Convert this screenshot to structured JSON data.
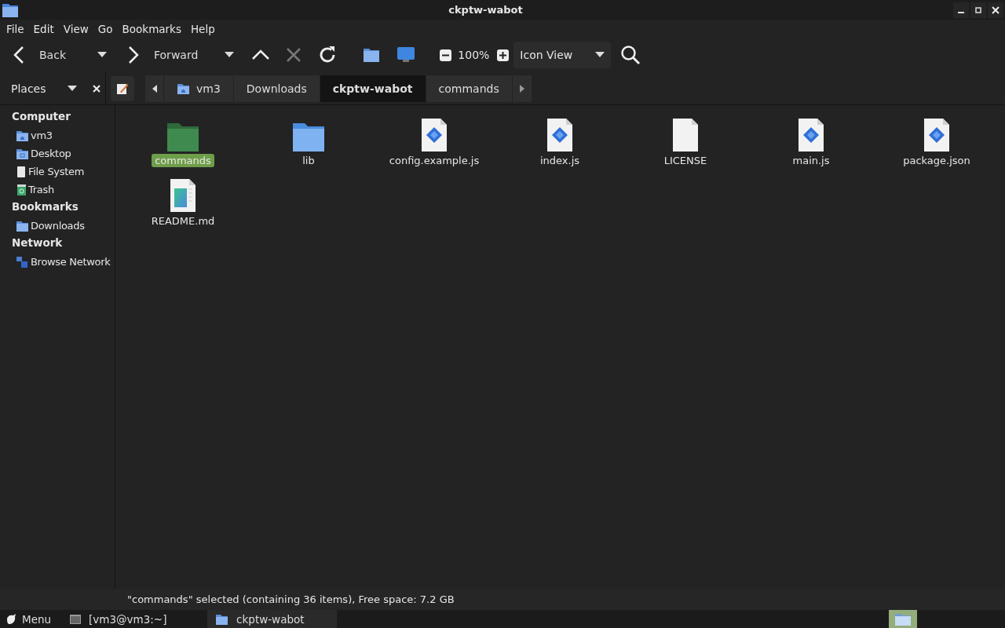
{
  "window": {
    "title": "ckptw-wabot"
  },
  "menu": [
    "File",
    "Edit",
    "View",
    "Go",
    "Bookmarks",
    "Help"
  ],
  "toolbar": {
    "back": "Back",
    "forward": "Forward",
    "stop_disabled": true,
    "zoom": "100%",
    "view": "Icon View"
  },
  "sidebar": {
    "label": "Places",
    "sections": [
      {
        "title": "Computer",
        "items": [
          {
            "label": "vm3",
            "kind": "home"
          },
          {
            "label": "Desktop",
            "kind": "desktop"
          },
          {
            "label": "File System",
            "kind": "drive"
          },
          {
            "label": "Trash",
            "kind": "trash"
          }
        ]
      },
      {
        "title": "Bookmarks",
        "items": [
          {
            "label": "Downloads",
            "kind": "folder"
          }
        ]
      },
      {
        "title": "Network",
        "items": [
          {
            "label": "Browse Network",
            "kind": "network"
          }
        ]
      }
    ]
  },
  "breadcrumb": [
    {
      "label": "vm3",
      "kind": "home",
      "selected": false
    },
    {
      "label": "Downloads",
      "kind": "plain",
      "selected": false
    },
    {
      "label": "ckptw-wabot",
      "kind": "plain",
      "selected": true
    },
    {
      "label": "commands",
      "kind": "plain",
      "selected": false
    }
  ],
  "files": [
    {
      "name": "commands",
      "kind": "folder",
      "selected": true
    },
    {
      "name": "lib",
      "kind": "folder",
      "selected": false
    },
    {
      "name": "config.example.js",
      "kind": "script",
      "selected": false
    },
    {
      "name": "index.js",
      "kind": "script",
      "selected": false
    },
    {
      "name": "LICENSE",
      "kind": "text",
      "selected": false
    },
    {
      "name": "main.js",
      "kind": "script",
      "selected": false
    },
    {
      "name": "package.json",
      "kind": "script",
      "selected": false
    },
    {
      "name": "README.md",
      "kind": "markdown",
      "selected": false
    }
  ],
  "status_bar": "\"commands\" selected (containing 36 items), Free space: 7.2 GB",
  "taskbar": {
    "menu": "Menu",
    "tasks": [
      {
        "label": "[vm3@vm3:~]",
        "kind": "terminal",
        "selected": false
      },
      {
        "label": "ckptw-wabot",
        "kind": "folder",
        "selected": true
      }
    ]
  }
}
